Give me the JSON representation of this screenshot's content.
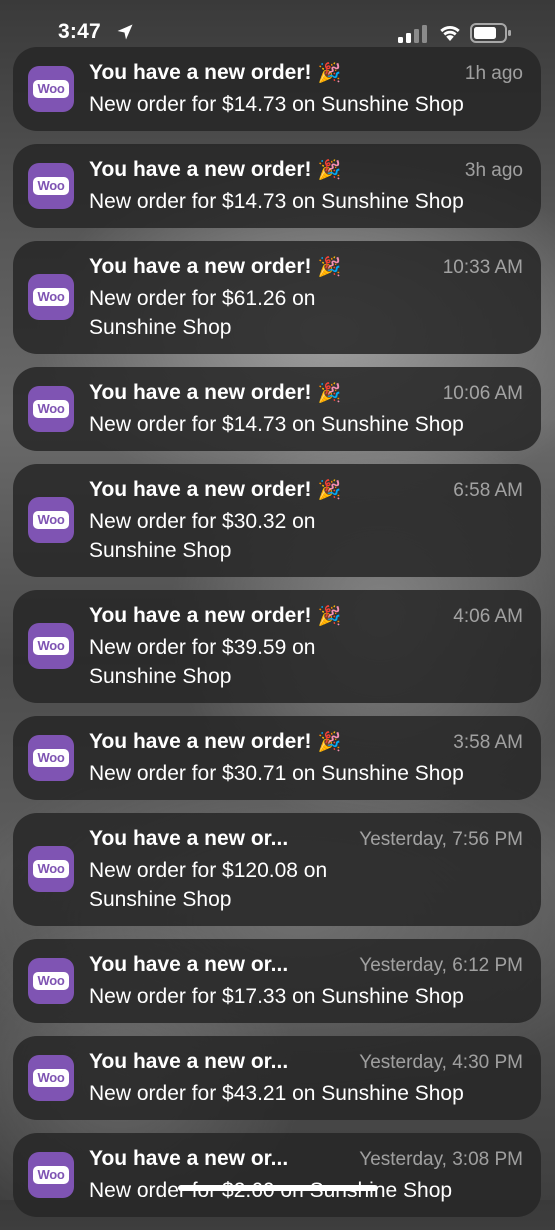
{
  "status_bar": {
    "time": "3:47"
  },
  "icons": {
    "location": "location-arrow-icon",
    "signal": "cellular-signal-icon",
    "wifi": "wifi-icon",
    "battery": "battery-icon",
    "app": "woocommerce-app-icon"
  },
  "app": {
    "badge_text": "Woo",
    "color": "#7f54b3"
  },
  "notifications": [
    {
      "title": "You have a new order!",
      "emoji": "🎉",
      "time": "1h ago",
      "body": "New order for $14.73 on Sunshine Shop"
    },
    {
      "title": "You have a new order!",
      "emoji": "🎉",
      "time": "3h ago",
      "body": "New order for $14.73 on Sunshine Shop"
    },
    {
      "title": "You have a new order!",
      "emoji": "🎉",
      "time": "10:33 AM",
      "body": "New order for $61.26 on Sunshine Shop"
    },
    {
      "title": "You have a new order!",
      "emoji": "🎉",
      "time": "10:06 AM",
      "body": "New order for $14.73 on Sunshine Shop"
    },
    {
      "title": "You have a new order!",
      "emoji": "🎉",
      "time": "6:58 AM",
      "body": "New order for $30.32 on Sunshine Shop"
    },
    {
      "title": "You have a new order!",
      "emoji": "🎉",
      "time": "4:06 AM",
      "body": "New order for $39.59 on Sunshine Shop"
    },
    {
      "title": "You have a new order!",
      "emoji": "🎉",
      "time": "3:58 AM",
      "body": "New order for $30.71 on Sunshine Shop"
    },
    {
      "title": "You have a new or...",
      "emoji": "",
      "time": "Yesterday, 7:56 PM",
      "body": "New order for $120.08 on Sunshine Shop"
    },
    {
      "title": "You have a new or...",
      "emoji": "",
      "time": "Yesterday, 6:12 PM",
      "body": "New order for $17.33 on Sunshine Shop"
    },
    {
      "title": "You have a new or...",
      "emoji": "",
      "time": "Yesterday, 4:30 PM",
      "body": "New order for $43.21 on Sunshine Shop"
    },
    {
      "title": "You have a new or...",
      "emoji": "",
      "time": "Yesterday, 3:08 PM",
      "body": "New order for $2.60 on Sunshine Shop"
    }
  ]
}
